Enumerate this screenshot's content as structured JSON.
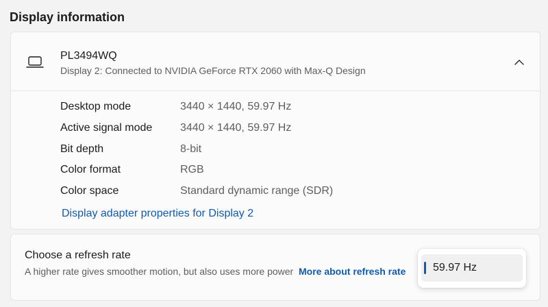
{
  "section": {
    "title": "Display information"
  },
  "display": {
    "icon": "laptop-icon",
    "name": "PL3494WQ",
    "description": "Display 2: Connected to NVIDIA GeForce RTX 2060 with Max-Q Design",
    "expanded": true,
    "info": [
      {
        "label": "Desktop mode",
        "value": "3440 × 1440, 59.97 Hz"
      },
      {
        "label": "Active signal mode",
        "value": "3440 × 1440, 59.97 Hz"
      },
      {
        "label": "Bit depth",
        "value": "8-bit"
      },
      {
        "label": "Color format",
        "value": "RGB"
      },
      {
        "label": "Color space",
        "value": "Standard dynamic range (SDR)"
      }
    ],
    "adapter_link": "Display adapter properties for Display 2"
  },
  "refresh": {
    "title": "Choose a refresh rate",
    "description": "A higher rate gives smoother motion, but also uses more power",
    "more_link": "More about refresh rate",
    "selected": "59.97 Hz"
  },
  "colors": {
    "accent": "#0f5bb0",
    "background": "#f3f3f3",
    "card": "#fbfbfb"
  }
}
